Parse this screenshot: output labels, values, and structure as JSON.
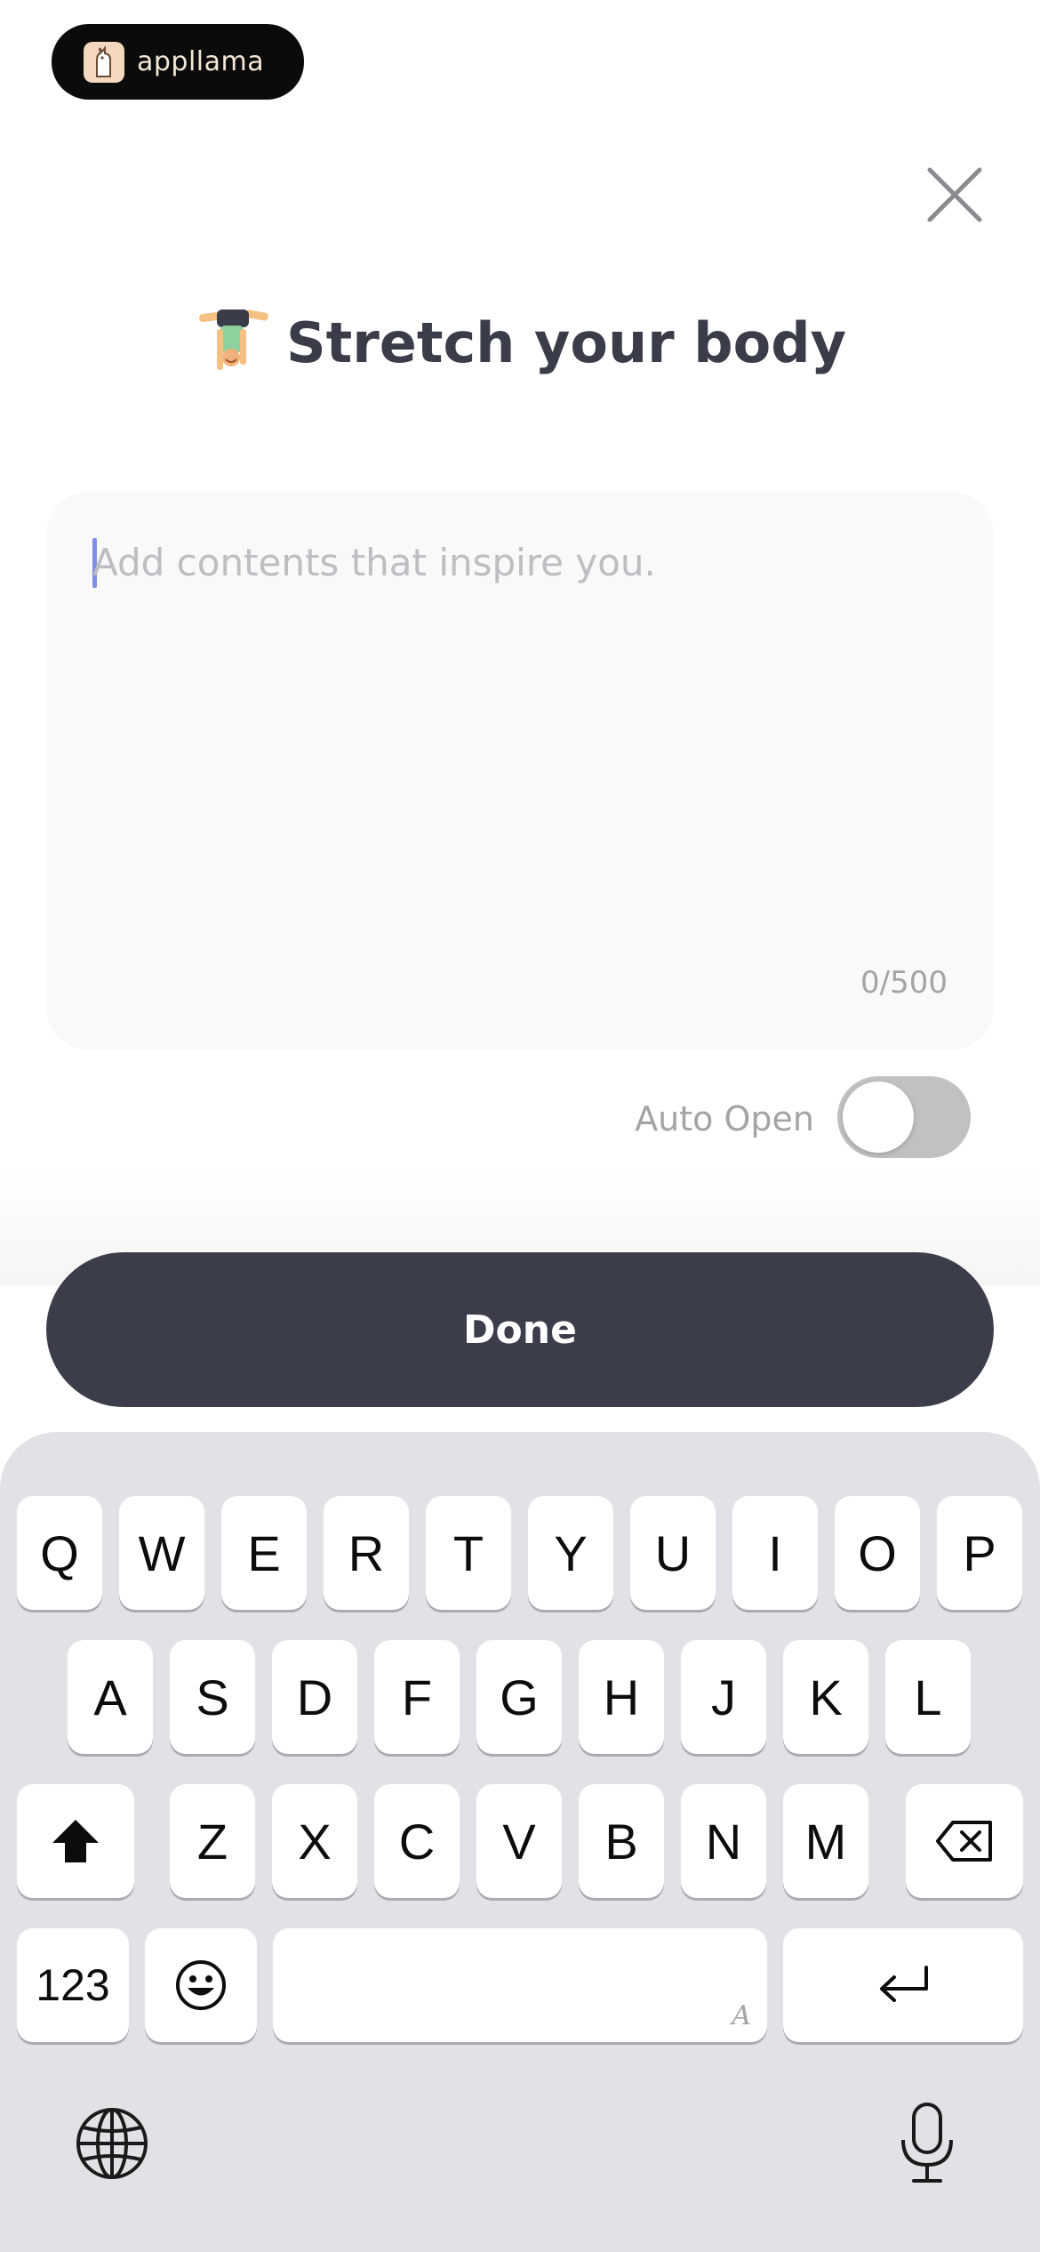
{
  "badge": {
    "label": "appllama",
    "icon": "llama-logo-icon"
  },
  "header": {
    "close_icon": "close-icon"
  },
  "title": {
    "emoji": "person-doing-handstand-icon",
    "text": "Stretch your body"
  },
  "editor": {
    "placeholder": "Add contents that inspire you.",
    "counter": "0/500"
  },
  "auto_open": {
    "label": "Auto Open",
    "enabled": false
  },
  "done_button": {
    "label": "Done"
  },
  "keyboard": {
    "row1": [
      "Q",
      "W",
      "E",
      "R",
      "T",
      "Y",
      "U",
      "I",
      "O",
      "P"
    ],
    "row2": [
      "A",
      "S",
      "D",
      "F",
      "G",
      "H",
      "J",
      "K",
      "L"
    ],
    "row3": [
      "Z",
      "X",
      "C",
      "V",
      "B",
      "N",
      "M"
    ],
    "numbers_label": "123",
    "space_hint": "A",
    "shift_icon": "shift-icon",
    "backspace_icon": "backspace-icon",
    "emoji_icon": "emoji-icon",
    "return_icon": "return-icon",
    "globe_icon": "globe-icon",
    "mic_icon": "microphone-icon"
  }
}
